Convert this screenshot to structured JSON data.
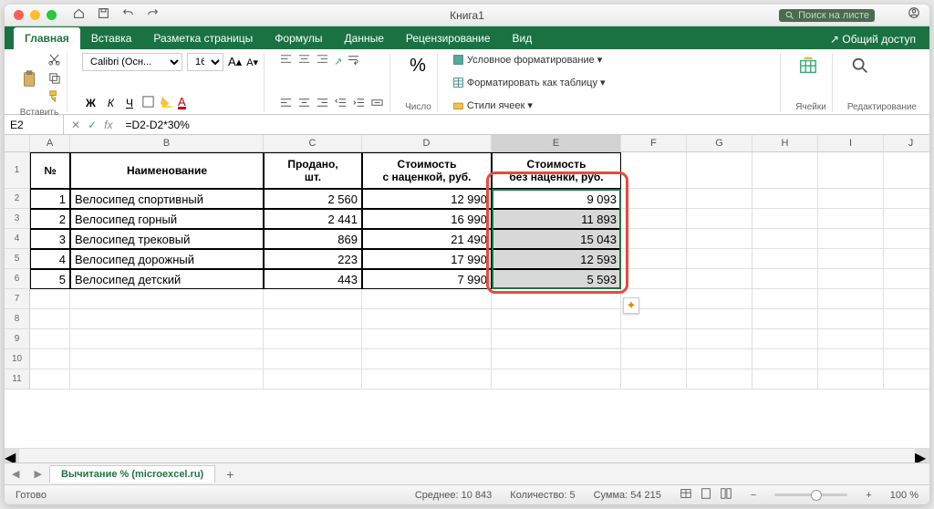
{
  "title": "Книга1",
  "search_placeholder": "Поиск на листе",
  "tabs": [
    "Главная",
    "Вставка",
    "Разметка страницы",
    "Формулы",
    "Данные",
    "Рецензирование",
    "Вид"
  ],
  "share": "Общий доступ",
  "ribbon": {
    "paste": "Вставить",
    "font_name": "Calibri (Осн...",
    "font_size": "16",
    "bold": "Ж",
    "italic": "К",
    "underline": "Ч",
    "number": "Число",
    "cond_fmt": "Условное форматирование",
    "as_table": "Форматировать как таблицу",
    "cell_styles": "Стили ячеек",
    "cells": "Ячейки",
    "editing": "Редактирование"
  },
  "cell_ref": "E2",
  "formula": "=D2-D2*30%",
  "cols": [
    "A",
    "B",
    "C",
    "D",
    "E",
    "F",
    "G",
    "H",
    "I",
    "J"
  ],
  "header": [
    "№",
    "Наименование",
    "Продано,\nшт.",
    "Стоимость\nс наценкой, руб.",
    "Стоимость\nбез наценки, руб."
  ],
  "data": [
    [
      "1",
      "Велосипед спортивный",
      "2 560",
      "12 990",
      "9 093"
    ],
    [
      "2",
      "Велосипед горный",
      "2 441",
      "16 990",
      "11 893"
    ],
    [
      "3",
      "Велосипед трековый",
      "869",
      "21 490",
      "15 043"
    ],
    [
      "4",
      "Велосипед дорожный",
      "223",
      "17 990",
      "12 593"
    ],
    [
      "5",
      "Велосипед детский",
      "443",
      "7 990",
      "5 593"
    ]
  ],
  "sheet": "Вычитание % (microexcel.ru)",
  "status": {
    "ready": "Готово",
    "avg": "Среднее: 10 843",
    "count": "Количество: 5",
    "sum": "Сумма: 54 215",
    "zoom": "100 %"
  },
  "chart_data": {
    "type": "table",
    "columns": [
      "№",
      "Наименование",
      "Продано шт",
      "Стоимость с наценкой",
      "Стоимость без наценки"
    ],
    "rows": [
      [
        1,
        "Велосипед спортивный",
        2560,
        12990,
        9093
      ],
      [
        2,
        "Велосипед горный",
        2441,
        16990,
        11893
      ],
      [
        3,
        "Велосипед трековый",
        869,
        21490,
        15043
      ],
      [
        4,
        "Велосипед дорожный",
        223,
        17990,
        12593
      ],
      [
        5,
        "Велосипед детский",
        443,
        7990,
        5593
      ]
    ]
  }
}
